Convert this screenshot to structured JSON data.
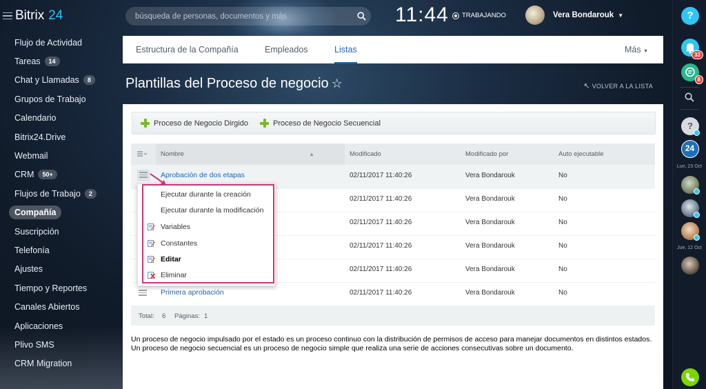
{
  "brand": {
    "name_a": "Bitrix",
    "name_b": "24"
  },
  "search": {
    "placeholder": "búsqueda de personas, documentos y más"
  },
  "clock": {
    "time": "11:44",
    "status": "TRABAJANDO"
  },
  "user": {
    "name": "Vera Bondarouk"
  },
  "sidebar": {
    "items": [
      {
        "label": "Flujo de Actividad"
      },
      {
        "label": "Tareas",
        "badge": "14"
      },
      {
        "label": "Chat y Llamadas",
        "badge": "8"
      },
      {
        "label": "Grupos de Trabajo"
      },
      {
        "label": "Calendario"
      },
      {
        "label": "Bitrix24.Drive"
      },
      {
        "label": "Webmail"
      },
      {
        "label": "CRM",
        "badge": "50+"
      },
      {
        "label": "Flujos de Trabajo",
        "badge": "2"
      },
      {
        "label": "Compañía",
        "active": true
      },
      {
        "label": "Suscripción"
      },
      {
        "label": "Telefonía"
      },
      {
        "label": "Ajustes"
      },
      {
        "label": "Tiempo y Reportes"
      },
      {
        "label": "Canales Abiertos"
      },
      {
        "label": "Aplicaciones"
      },
      {
        "label": "Plivo SMS"
      },
      {
        "label": "CRM Migration"
      }
    ]
  },
  "tabs": {
    "items": [
      {
        "label": "Estructura de la Compañía"
      },
      {
        "label": "Empleados"
      },
      {
        "label": "Listas",
        "active": true
      }
    ],
    "more": "Más"
  },
  "page": {
    "title": "Plantillas del Proceso de negocio",
    "back": "VOLVER A LA LISTA"
  },
  "toolbar": {
    "add_state": "Proceso de Negocio Dirgido",
    "add_sequential": "Proceso de Negocio Secuencial"
  },
  "grid": {
    "headers": {
      "name": "Nombre",
      "modified": "Modificado",
      "modified_by": "Modificado por",
      "auto": "Auto ejecutable"
    },
    "rows": [
      {
        "name": "Aprobación de dos etapas",
        "modified": "02/11/2017 11:40:26",
        "modified_by": "Vera Bondarouk",
        "auto": "No"
      },
      {
        "name": "",
        "modified": "02/11/2017 11:40:26",
        "modified_by": "Vera Bondarouk",
        "auto": "No"
      },
      {
        "name": "",
        "modified": "02/11/2017 11:40:26",
        "modified_by": "Vera Bondarouk",
        "auto": "No"
      },
      {
        "name": "",
        "modified": "02/11/2017 11:40:26",
        "modified_by": "Vera Bondarouk",
        "auto": "No"
      },
      {
        "name": "",
        "modified": "02/11/2017 11:40:26",
        "modified_by": "Vera Bondarouk",
        "auto": "No"
      },
      {
        "name": "Primera aprobación",
        "modified": "02/11/2017 11:40:26",
        "modified_by": "Vera Bondarouk",
        "auto": "No"
      }
    ],
    "footer": {
      "total_label": "Total:",
      "total": "6",
      "pages_label": "Páginas:",
      "pages": "1"
    }
  },
  "context_menu": {
    "items": [
      {
        "label": "Ejecutar durante la creación"
      },
      {
        "label": "Ejecutar durante la modificación"
      },
      {
        "label": "Variables",
        "icon": "edit-icon"
      },
      {
        "label": "Constantes",
        "icon": "edit-icon"
      },
      {
        "label": "Editar",
        "icon": "edit-icon",
        "bold": true
      },
      {
        "label": "Eliminar",
        "icon": "delete-icon"
      }
    ]
  },
  "description": {
    "line1": "Un proceso de negocio impulsado por el estado es un proceso continuo con la distribución de permisos de acceso para manejar documentos en distintos estados.",
    "line2": "Un proceso de negocio secuencial es un proceso de negocio simple que realiza una serie de acciones consecutivas sobre un documento."
  },
  "right_sidebar": {
    "help": "?",
    "notifications_badge": "33",
    "messages_badge": "8",
    "logo_24": "24",
    "date1": "Lun, 23 Oct",
    "date2": "Jue, 12 Oct"
  }
}
